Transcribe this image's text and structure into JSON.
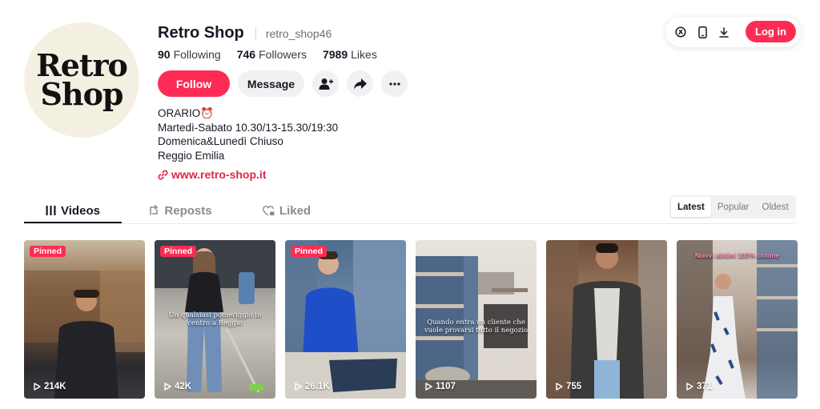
{
  "profile": {
    "avatar_lines": [
      "Retro",
      "Shop"
    ],
    "display_name": "Retro Shop",
    "username": "retro_shop46",
    "stats": [
      {
        "value": "90",
        "label": "Following"
      },
      {
        "value": "746",
        "label": "Followers"
      },
      {
        "value": "7989",
        "label": "Likes"
      }
    ],
    "follow_label": "Follow",
    "message_label": "Message",
    "bio": [
      "ORARIO⏰",
      "Martedì-Sabato 10.30/13-15.30/19:30",
      "Domenica&Lunedì Chiuso",
      "Reggio Emilia"
    ],
    "link": "www.retro-shop.it"
  },
  "topbar": {
    "login_label": "Log in",
    "icons": [
      "coin-icon",
      "phone-icon",
      "download-icon"
    ]
  },
  "tabs": [
    "Videos",
    "Reposts",
    "Liked"
  ],
  "sort": {
    "options": [
      "Latest",
      "Popular",
      "Oldest"
    ],
    "selected": "Latest"
  },
  "videos": [
    {
      "pinned": "Pinned",
      "views": "214K",
      "caption": ""
    },
    {
      "pinned": "Pinned",
      "views": "42K",
      "caption": "Un qualsiasi pomeriggio in centro a Reggio"
    },
    {
      "pinned": "Pinned",
      "views": "26.1K",
      "caption": ""
    },
    {
      "pinned": "",
      "views": "1107",
      "caption": "Quando entra un cliente che vuole provarsi tutto il negozio"
    },
    {
      "pinned": "",
      "views": "755",
      "caption": ""
    },
    {
      "pinned": "",
      "views": "371",
      "caption": "Nuovi abitini 100% cotone"
    }
  ],
  "colors": {
    "accent": "#fe2c55",
    "link": "#e0264a"
  }
}
